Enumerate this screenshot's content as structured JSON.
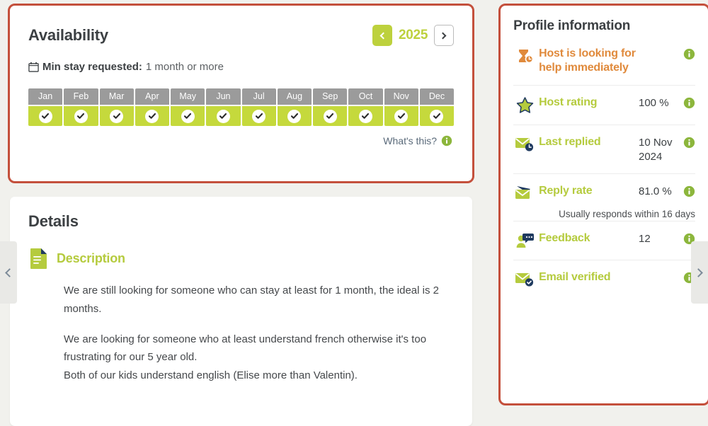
{
  "availability": {
    "title": "Availability",
    "year": "2025",
    "prev_icon": "chevron-left-icon",
    "next_icon": "chevron-right-icon",
    "calendar_icon": "calendar-icon",
    "min_stay_label": "Min stay requested:",
    "min_stay_value": "1 month or more",
    "months": [
      {
        "name": "Jan",
        "available": true
      },
      {
        "name": "Feb",
        "available": true
      },
      {
        "name": "Mar",
        "available": true
      },
      {
        "name": "Apr",
        "available": true
      },
      {
        "name": "May",
        "available": true
      },
      {
        "name": "Jun",
        "available": true
      },
      {
        "name": "Jul",
        "available": true
      },
      {
        "name": "Aug",
        "available": true
      },
      {
        "name": "Sep",
        "available": true
      },
      {
        "name": "Oct",
        "available": true
      },
      {
        "name": "Nov",
        "available": true
      },
      {
        "name": "Dec",
        "available": true
      }
    ],
    "whats_this": "What's this?"
  },
  "details": {
    "title": "Details",
    "description_label": "Description",
    "description_icon": "document-icon",
    "paragraphs": [
      "We are still looking for someone who can stay at least for 1 month, the ideal is 2 months.",
      "We are looking for someone who at least understand french otherwise it's too frustrating for our 5 year old.\nBoth of our kids understand english (Elise more than Valentin)."
    ],
    "para1": "We are still looking for someone who can stay at least for 1 month, the ideal is 2 months.",
    "para2a": "We are looking for someone who at least understand french otherwise it's too frustrating for our 5 year old.",
    "para2b": "Both of our kids understand english (Elise more than Valentin)."
  },
  "profile": {
    "title": "Profile information",
    "rows": [
      {
        "icon": "hourglass-clock-icon",
        "label": "Host is looking for help immediately",
        "value": "",
        "info": true,
        "accent": "#e08a3c"
      },
      {
        "icon": "star-icon",
        "label": "Host rating",
        "value": "100 %",
        "info": true,
        "accent": "#b5cb3e"
      },
      {
        "icon": "envelope-clock-icon",
        "label": "Last replied",
        "value": "10 Nov 2024",
        "info": true,
        "accent": "#b5cb3e"
      },
      {
        "icon": "envelope-send-icon",
        "label": "Reply rate",
        "value": "81.0 %",
        "sub": "Usually responds within 16 days",
        "info": true,
        "accent": "#b5cb3e"
      },
      {
        "icon": "feedback-icon",
        "label": "Feedback",
        "value": "12",
        "info": true,
        "accent": "#b5cb3e"
      },
      {
        "icon": "envelope-verified-icon",
        "label": "Email verified",
        "value": "",
        "info": true,
        "accent": "#b5cb3e"
      }
    ]
  },
  "nav": {
    "prev_icon": "chevron-left-icon",
    "next_icon": "chevron-right-icon"
  },
  "colors": {
    "green": "#b5cb3e",
    "green_cell": "#c5d93c",
    "orange": "#e08a3c",
    "navy": "#1f3a5f",
    "gray_header": "#9b9b9b",
    "annotation": "#c4503c",
    "page_bg": "#f1f1ed"
  }
}
